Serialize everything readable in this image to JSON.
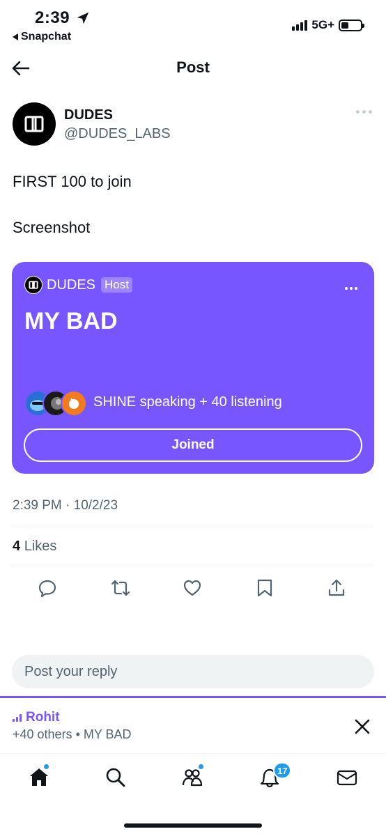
{
  "status_bar": {
    "time": "2:39",
    "back_app": "Snapchat",
    "network": "5G+"
  },
  "header": {
    "title": "Post"
  },
  "post": {
    "author_name": "DUDES",
    "author_handle": "@DUDES_LABS",
    "text_line1": "FIRST 100 to join",
    "text_line2": "Screenshot",
    "timestamp": "2:39 PM · 10/2/23",
    "likes_count": "4",
    "likes_label": "Likes"
  },
  "space_card": {
    "host_name": "DUDES",
    "host_badge": "Host",
    "title": "MY BAD",
    "speaker_text": "SHINE speaking + 40 listening",
    "joined_label": "Joined",
    "background_color": "#7856ff"
  },
  "reply": {
    "placeholder": "Post your reply"
  },
  "docked_space": {
    "speaker": "Rohit",
    "subtitle": "+40 others • MY BAD"
  },
  "tab_bar": {
    "notifications_badge": "17",
    "items": [
      "home-icon",
      "search-icon",
      "communities-icon",
      "notifications-icon",
      "messages-icon"
    ]
  },
  "colors": {
    "accent": "#1d9bf0",
    "spaces": "#7856ff",
    "secondary_text": "#536471"
  }
}
